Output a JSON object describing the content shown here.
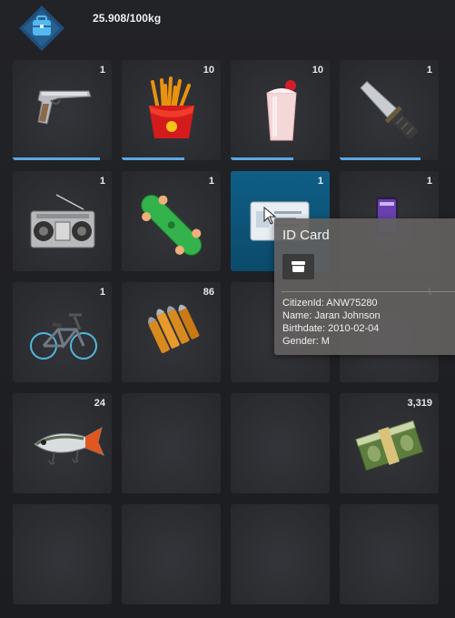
{
  "header": {
    "icon": "backpack-icon",
    "weight": "25.908/100kg"
  },
  "slots": [
    {
      "item": "pistol-icon",
      "count": "1",
      "durability": 0.88
    },
    {
      "item": "fries-icon",
      "count": "10",
      "durability": 0.63
    },
    {
      "item": "milkshake-icon",
      "count": "10",
      "durability": 0.63
    },
    {
      "item": "knife-icon",
      "count": "1",
      "durability": 0.82
    },
    {
      "item": "boombox-icon",
      "count": "1"
    },
    {
      "item": "skateboard-icon",
      "count": "1"
    },
    {
      "item": "id-card-icon",
      "count": "1",
      "selected": true
    },
    {
      "item": "phone-icon",
      "count": "1"
    },
    {
      "item": "bmx-icon",
      "count": "1"
    },
    {
      "item": "ammo-icon",
      "count": "86"
    },
    {
      "item": "",
      "count": ""
    },
    {
      "item": "",
      "count": "1"
    },
    {
      "item": "fishing-lure-icon",
      "count": "24"
    },
    {
      "item": "",
      "count": ""
    },
    {
      "item": "",
      "count": ""
    },
    {
      "item": "cash-stack-icon",
      "count": "3,319"
    },
    {
      "item": "",
      "count": ""
    },
    {
      "item": "",
      "count": ""
    },
    {
      "item": "",
      "count": ""
    },
    {
      "item": "",
      "count": ""
    }
  ],
  "tooltip": {
    "title": "ID Card",
    "icon": "box-icon",
    "lines": [
      "CitizenId: ANW75280",
      "Name: Jaran Johnson",
      "Birthdate: 2010-02-04",
      "Gender: M"
    ]
  },
  "colors": {
    "background": "#1f2024",
    "slot": "#2b2c30",
    "selected_slot": "#0f5e86",
    "durability_bar": "#59a8e6",
    "tooltip_bg": "#62605f"
  }
}
